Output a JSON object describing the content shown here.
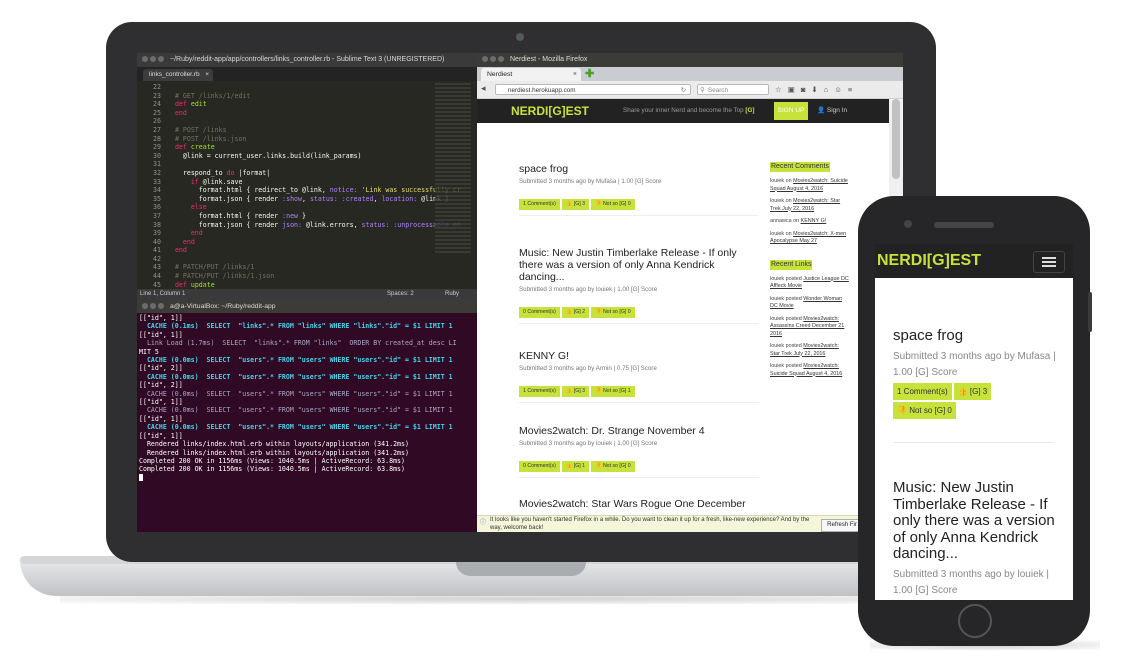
{
  "sublime": {
    "title": "~/Ruby/reddit-app/app/controllers/links_controller.rb - Sublime Text 3 (UNREGISTERED)",
    "tab": "links_controller.rb",
    "line_numbers": "22\n23\n24\n25\n26\n27\n28\n29\n30\n31\n32\n33\n34\n35\n36\n37\n38\n39\n40\n41\n42\n43\n44\n45\n46",
    "status_left": "Line 1, Column 1",
    "status_spaces": "Spaces: 2",
    "status_lang": "Ruby"
  },
  "terminal": {
    "title": "a@a-VirtualBox: ~/Ruby/reddit-app"
  },
  "firefox": {
    "title": "Nerdiest - Mozilla Firefox",
    "tab": "Nerdiest",
    "url": "nerdiest.herokuapp.com",
    "search_placeholder": "Search",
    "notification": "It looks like you haven't started Firefox in a while. Do you want to clean it up for a fresh, like-new experience? And by the way, welcome back!",
    "notification_button": "Refresh Fir"
  },
  "site": {
    "logo": "NERDI[G]EST",
    "tagline_prefix": "Share your inner Nerd and become the Top",
    "tagline_highlight": "[G]",
    "signup": "SIGN UP",
    "signin": "Sign In"
  },
  "posts": [
    {
      "title": "space frog",
      "meta": "Submitted 3 months ago by Mufasa | 1.00 [G] Score",
      "comments": "1 Comment(s)",
      "up": "[G] 3",
      "down": "Not so [G] 0"
    },
    {
      "title": "Music: New Justin Timberlake Release - If only there was a version of only Anna Kendrick dancing...",
      "meta": "Submitted 3 months ago by louiek | 1.00 [G] Score",
      "comments": "0 Comment(s)",
      "up": "[G] 2",
      "down": "Not so [G] 0"
    },
    {
      "title": "KENNY G!",
      "meta": "Submitted 3 months ago by Armin | 0.75 [G] Score",
      "comments": "1 Comment(s)",
      "up": "[G] 3",
      "down": "Not so [G] 1"
    },
    {
      "title": "Movies2watch: Dr. Strange November 4",
      "meta": "Submitted 3 months ago by louiek | 1.00 [G] Score",
      "comments": "0 Comment(s)",
      "up": "[G] 1",
      "down": "Not so [G] 0"
    },
    {
      "title": "Movies2watch: Star Wars Rogue One December"
    }
  ],
  "sidebar": {
    "recent_comments_heading": "Recent Comments",
    "comments": [
      {
        "user": "louiek",
        "connector": "on",
        "link": "Movies2watch: Suicide Squad August 4, 2016"
      },
      {
        "user": "louiek",
        "connector": "on",
        "link": "Movies2watch: Star Trek July 22, 2016"
      },
      {
        "user": "annawca",
        "connector": "on",
        "link": "KENNY G!"
      },
      {
        "user": "louiek",
        "connector": "on",
        "link": "Movies2watch: X-men Apocalypse May 27"
      }
    ],
    "recent_links_heading": "Recent Links",
    "links": [
      {
        "user": "louiek",
        "connector": "posted",
        "link": "Justice League DC Affleck Movie"
      },
      {
        "user": "louiek",
        "connector": "posted",
        "link": "Wonder Woman DC Movie"
      },
      {
        "user": "louiek",
        "connector": "posted",
        "link": "Movies2watch: Assassins Creed December 21 2016"
      },
      {
        "user": "louiek",
        "connector": "posted",
        "link": "Movies2watch: Star Trek July 22, 2016"
      },
      {
        "user": "louiek",
        "connector": "posted",
        "link": "Movies2watch: Suicide Squad August 4, 2016"
      }
    ]
  },
  "phone": {
    "logo": "NERDI[G]EST",
    "post1_title": "space frog",
    "post1_meta": "Submitted 3 months ago by Mufasa | 1.00 [G] Score",
    "post1_comments": "1 Comment(s)",
    "post1_up": "[G] 3",
    "post1_down": "Not so [G] 0",
    "post2_title": "Music: New Justin Timberlake Release - If only there was a version of only Anna Kendrick dancing...",
    "post2_meta": "Submitted 3 months ago by louiek | 1.00 [G] Score"
  },
  "colors": {
    "accent": "#c7e23a",
    "navbar": "#222222",
    "terminal_bg": "#300a24",
    "editor_bg": "#272822"
  }
}
